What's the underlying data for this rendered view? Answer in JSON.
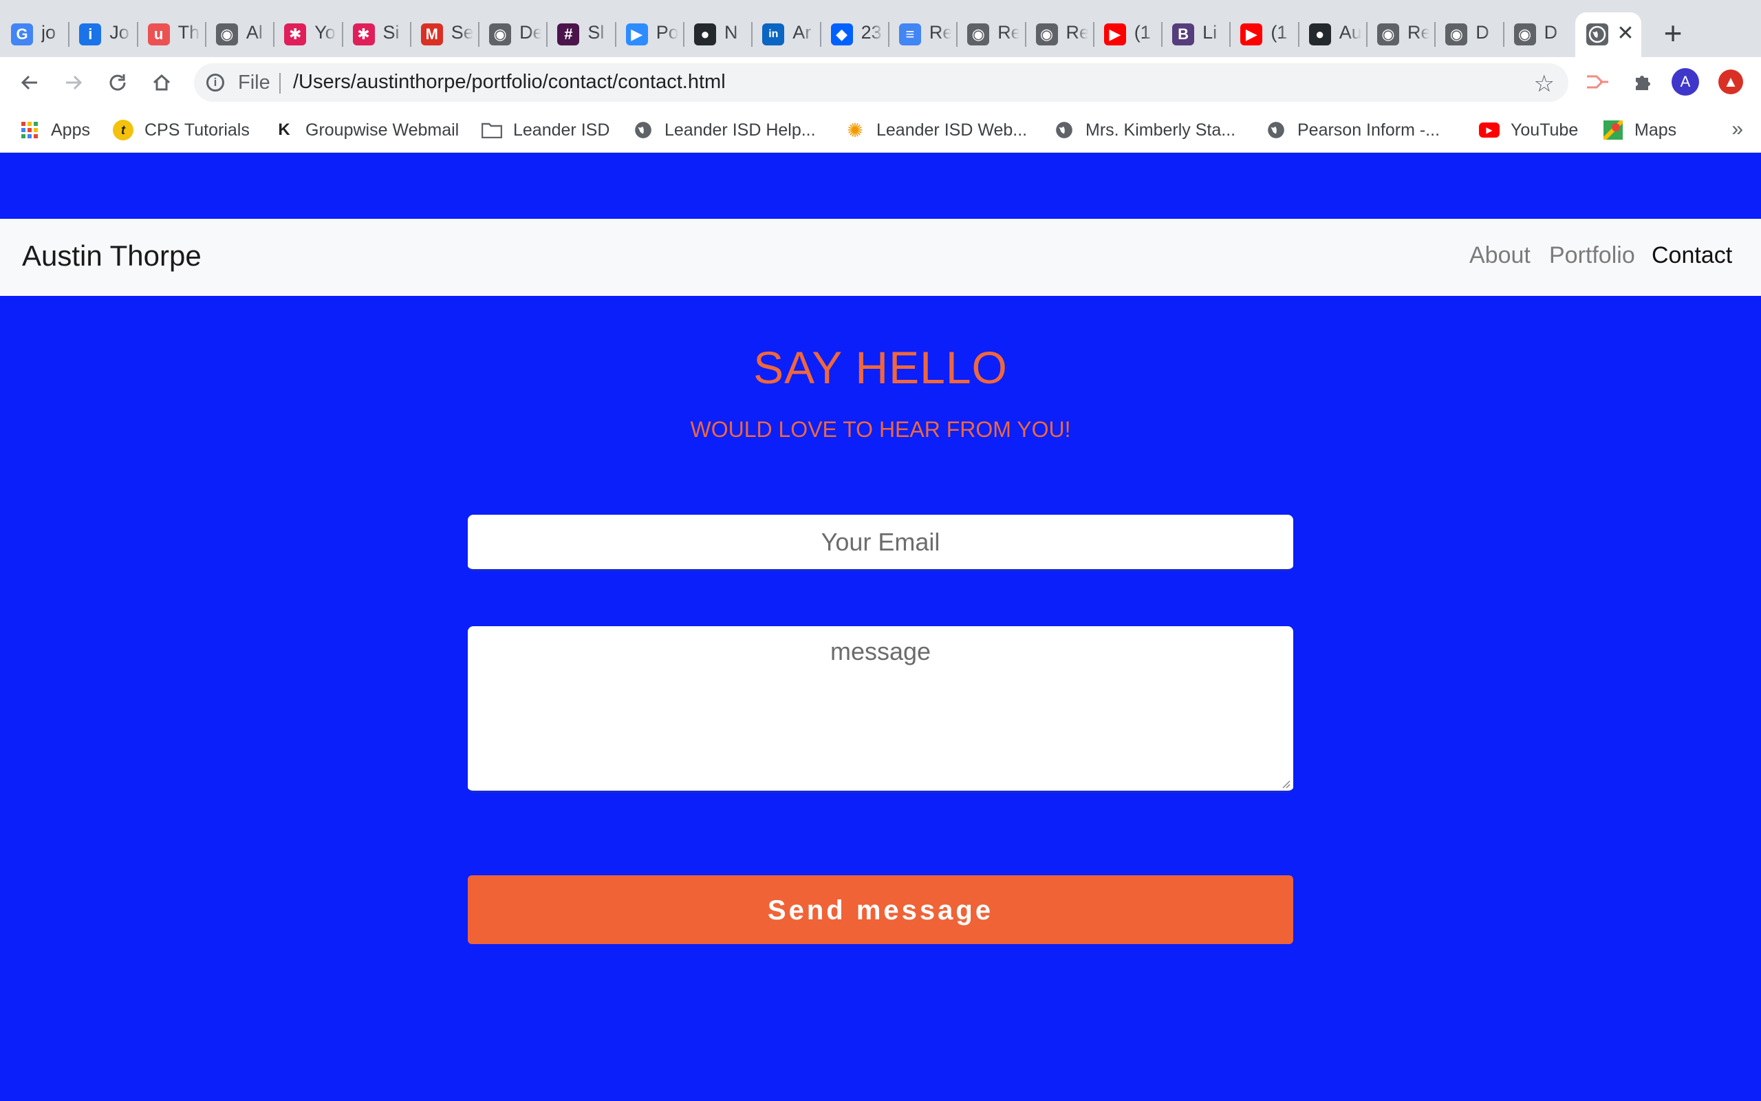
{
  "browser": {
    "tabs": [
      {
        "title": "jo",
        "icon": "google-icon",
        "color": "#4285f4",
        "glyph": "G"
      },
      {
        "title": "Jo",
        "icon": "info-i-icon",
        "color": "#1a73e8",
        "glyph": "i"
      },
      {
        "title": "Th",
        "icon": "udemy-icon",
        "color": "#ec5252",
        "glyph": "u"
      },
      {
        "title": "Al",
        "icon": "globe-icon",
        "color": "#5f6368",
        "glyph": "◉"
      },
      {
        "title": "Yo",
        "icon": "slack-icon",
        "color": "#e01e5a",
        "glyph": "✱"
      },
      {
        "title": "Si",
        "icon": "slack-icon",
        "color": "#e01e5a",
        "glyph": "✱"
      },
      {
        "title": "Se",
        "icon": "gmail-icon",
        "color": "#d93025",
        "glyph": "M"
      },
      {
        "title": "De",
        "icon": "globe-icon",
        "color": "#5f6368",
        "glyph": "◉"
      },
      {
        "title": "Sl",
        "icon": "slack-dark-icon",
        "color": "#4a154b",
        "glyph": "#"
      },
      {
        "title": "Po",
        "icon": "zoom-icon",
        "color": "#2d8cff",
        "glyph": "▶"
      },
      {
        "title": "N",
        "icon": "github-icon",
        "color": "#24292e",
        "glyph": "●"
      },
      {
        "title": "Ar",
        "icon": "linkedin-icon",
        "color": "#0a66c2",
        "glyph": "in"
      },
      {
        "title": "23",
        "icon": "dropbox-icon",
        "color": "#0061ff",
        "glyph": "◆"
      },
      {
        "title": "Re",
        "icon": "google-docs-icon",
        "color": "#4285f4",
        "glyph": "≡"
      },
      {
        "title": "Re",
        "icon": "globe-icon",
        "color": "#5f6368",
        "glyph": "◉"
      },
      {
        "title": "Re",
        "icon": "globe-icon",
        "color": "#5f6368",
        "glyph": "◉"
      },
      {
        "title": "(1",
        "icon": "youtube-icon",
        "color": "#ff0000",
        "glyph": "▶"
      },
      {
        "title": "Li",
        "icon": "bootstrap-icon",
        "color": "#563d7c",
        "glyph": "B"
      },
      {
        "title": "(1",
        "icon": "youtube-icon",
        "color": "#ff0000",
        "glyph": "▶"
      },
      {
        "title": "Au",
        "icon": "github-icon",
        "color": "#24292e",
        "glyph": "●"
      },
      {
        "title": "Re",
        "icon": "globe-icon",
        "color": "#5f6368",
        "glyph": "◉"
      },
      {
        "title": "D",
        "icon": "globe-icon",
        "color": "#5f6368",
        "glyph": "◉"
      },
      {
        "title": "D",
        "icon": "globe-icon",
        "color": "#5f6368",
        "glyph": "◉"
      }
    ],
    "active_tab_icon": "globe-icon",
    "active_tab_close": "✕",
    "new_tab": "+",
    "omnibox": {
      "scheme": "File",
      "url": "/Users/austinthorpe/portfolio/contact/contact.html"
    },
    "profile_initial": "A",
    "bookmarks": [
      {
        "label": "Apps",
        "icon": "apps-grid-icon",
        "color": "#ea4335"
      },
      {
        "label": "CPS Tutorials",
        "icon": "cps-icon",
        "color": "#f4c20d"
      },
      {
        "label": "Groupwise Webmail",
        "icon": "groupwise-icon",
        "color": "#222222"
      },
      {
        "label": "Leander ISD",
        "icon": "folder-icon",
        "color": "#5f6368"
      },
      {
        "label": "Leander ISD Help...",
        "icon": "globe-icon",
        "color": "#5f6368"
      },
      {
        "label": "Leander ISD Web...",
        "icon": "sun-icon",
        "color": "#f29900"
      },
      {
        "label": "Mrs. Kimberly Sta...",
        "icon": "globe-icon",
        "color": "#5f6368"
      },
      {
        "label": "Pearson Inform -...",
        "icon": "globe-icon",
        "color": "#5f6368"
      },
      {
        "label": "YouTube",
        "icon": "youtube-icon",
        "color": "#ff0000"
      },
      {
        "label": "Maps",
        "icon": "maps-icon",
        "color": "#34a853"
      }
    ],
    "bookmarks_overflow": "»"
  },
  "site": {
    "brand": "Austin Thorpe",
    "nav": [
      {
        "label": "About",
        "active": false
      },
      {
        "label": "Portfolio",
        "active": false
      },
      {
        "label": "Contact",
        "active": true
      }
    ],
    "title": "SAY HELLO",
    "subtitle": "WOULD LOVE TO HEAR FROM YOU!",
    "form": {
      "email_placeholder": "Your Email",
      "message_placeholder": "message",
      "submit_label": "Send message"
    }
  },
  "colors": {
    "page_background": "#0a1ffa",
    "accent": "#ef6337",
    "navbar_background": "#f8f9fa"
  }
}
